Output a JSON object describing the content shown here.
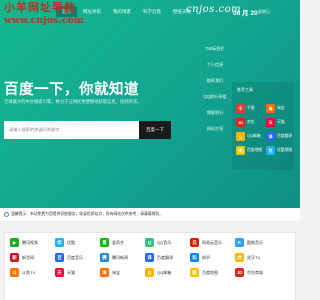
{
  "watermark": {
    "name": "小羊网址导航",
    "url": "www.cnjos.com"
  },
  "nav": {
    "items": [
      "首页",
      "网址导航",
      "我的博客",
      "科学云盘",
      "壁纸天地"
    ],
    "active_index": 0
  },
  "logo": "cnjos.com",
  "date": {
    "day": "06 月 20",
    "weekday": "星期日"
  },
  "hero": {
    "headline": "百度一下，你就知道",
    "subtext": "全球最大的中文搜索引擎，致力于让网民更便捷地获取信息，找到所求。",
    "search_placeholder": "请输入搜索的关键词关键字",
    "search_button": "百度一下"
  },
  "side_links": [
    "Tab标签栏",
    "个人信息",
    "联系我们",
    "QQ群分享组",
    "博客积分",
    "网站介绍"
  ],
  "panel": {
    "title": "推荐工具",
    "items": [
      {
        "label": "千图",
        "icon": "qian-icon",
        "color": "#e63b2e",
        "glyph": "千"
      },
      {
        "label": "淘宝",
        "icon": "taobao-icon",
        "color": "#ff6a00",
        "glyph": "淘"
      },
      {
        "label": "京东",
        "icon": "jd-icon",
        "color": "#e1251b",
        "glyph": "JD"
      },
      {
        "label": "天猫",
        "icon": "tmall-icon",
        "color": "#ff0036",
        "glyph": "天"
      },
      {
        "label": "QQ邮箱",
        "icon": "qqmail-icon",
        "color": "#f7b500",
        "glyph": "Q"
      },
      {
        "label": "百度翻译",
        "icon": "baidu-translate-icon",
        "color": "#2468f2",
        "glyph": "译"
      },
      {
        "label": "百度地图",
        "icon": "baidu-map-icon",
        "color": "#f5c400",
        "glyph": "图"
      },
      {
        "label": "优酷视频",
        "icon": "youku-icon",
        "color": "#1ab0f2",
        "glyph": "优"
      }
    ]
  },
  "notice": "温馨提示：本站免费为您提供导航服务，收录优质站点，所有网站仅供参考，请谨慎辨别。",
  "sites": [
    {
      "label": "腾讯视频",
      "color": "#1aad19",
      "glyph": "▶"
    },
    {
      "label": "优酷",
      "color": "#1ab0f2",
      "glyph": "优"
    },
    {
      "label": "爱奇艺",
      "color": "#00be06",
      "glyph": "爱"
    },
    {
      "label": "QQ音乐",
      "color": "#31c27c",
      "glyph": "Q"
    },
    {
      "label": "网易云音乐",
      "color": "#d81e06",
      "glyph": "云"
    },
    {
      "label": "酷狗音乐",
      "color": "#2ca2f9",
      "glyph": "K"
    },
    {
      "label": "新华网",
      "color": "#c8161d",
      "glyph": "新"
    },
    {
      "label": "百度音乐",
      "color": "#2468f2",
      "glyph": "百"
    },
    {
      "label": "腾讯新闻",
      "color": "#1e88e5",
      "glyph": "腾"
    },
    {
      "label": "百度翻译",
      "color": "#2468f2",
      "glyph": "译"
    },
    {
      "label": "知乎",
      "color": "#0084ff",
      "glyph": "知"
    },
    {
      "label": "虎牙TV",
      "color": "#ffb400",
      "glyph": "虎"
    },
    {
      "label": "斗鱼TV",
      "color": "#ff7200",
      "glyph": "斗"
    },
    {
      "label": "天猫",
      "color": "#ff0036",
      "glyph": "天"
    },
    {
      "label": "淘宝",
      "color": "#ff6a00",
      "glyph": "淘"
    },
    {
      "label": "QQ邮箱",
      "color": "#f7b500",
      "glyph": "Q"
    },
    {
      "label": "百度地图",
      "color": "#f5c400",
      "glyph": "图"
    },
    {
      "label": "京东商城",
      "color": "#e1251b",
      "glyph": "JD"
    }
  ]
}
